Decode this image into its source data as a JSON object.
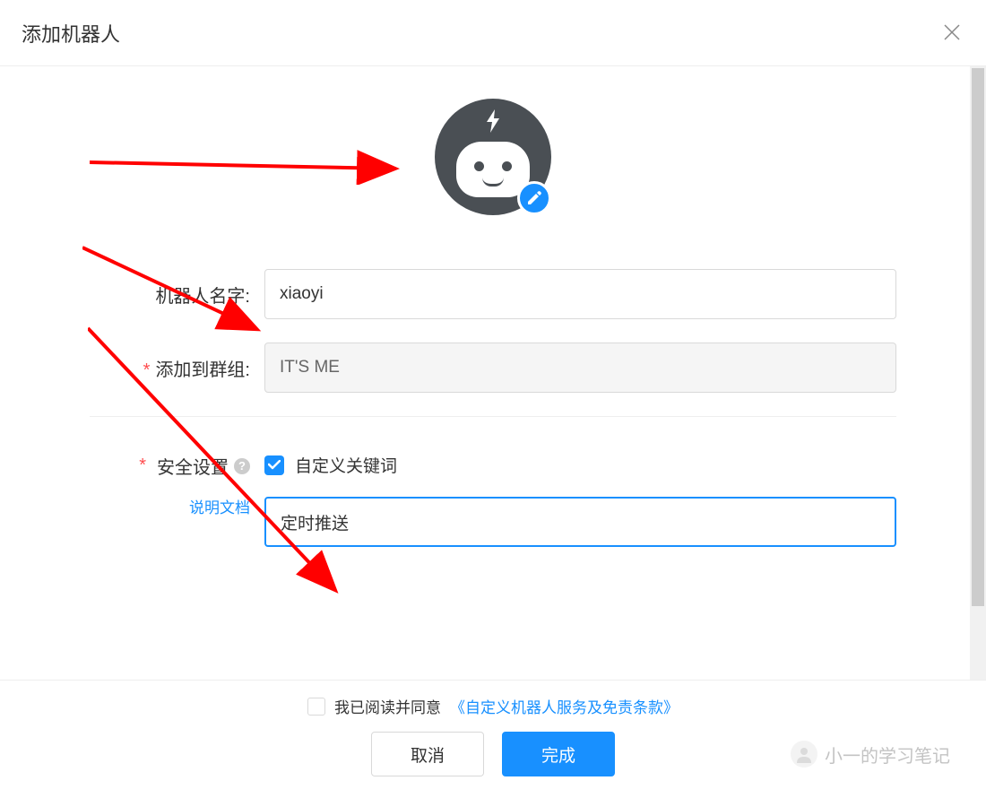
{
  "dialog": {
    "title": "添加机器人"
  },
  "form": {
    "name_label": "机器人名字:",
    "name_value": "xiaoyi",
    "group_label": "添加到群组:",
    "group_value": "IT'S ME"
  },
  "security": {
    "label": "安全设置",
    "doc_link": "说明文档",
    "keyword_checkbox_label": "自定义关键词",
    "keyword_checked": true,
    "keyword_value": "定时推送"
  },
  "footer": {
    "agreement_prefix": "我已阅读并同意",
    "agreement_link": "《自定义机器人服务及免责条款》",
    "cancel": "取消",
    "confirm": "完成"
  },
  "watermark": {
    "text": "小一的学习笔记"
  },
  "colors": {
    "primary": "#1890ff",
    "danger": "#ff4d4f",
    "avatar_bg": "#4a4f54"
  }
}
